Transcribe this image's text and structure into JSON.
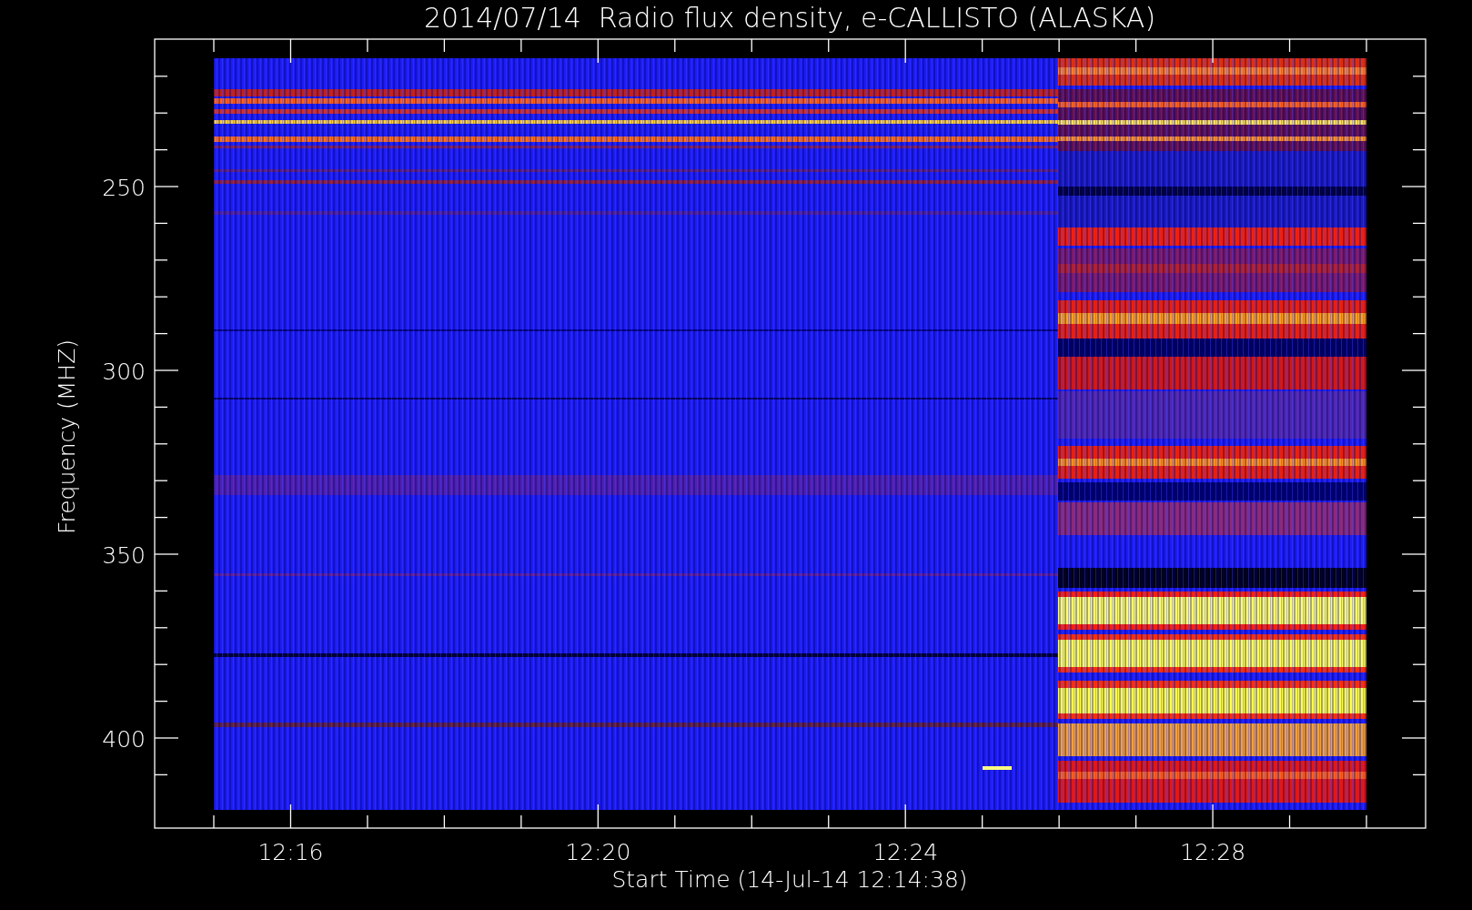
{
  "chart": {
    "title": "2014/07/14  Radio flux density, e-CALLISTO (ALASKA)",
    "ylabel": "Frequency (MHZ)",
    "xlabel": "Start Time (14-Jul-14 12:14:38)",
    "y_tick_labels": [
      "250",
      "300",
      "350",
      "400"
    ],
    "x_tick_labels": [
      "12:16",
      "12:20",
      "12:24",
      "12:28"
    ]
  }
}
